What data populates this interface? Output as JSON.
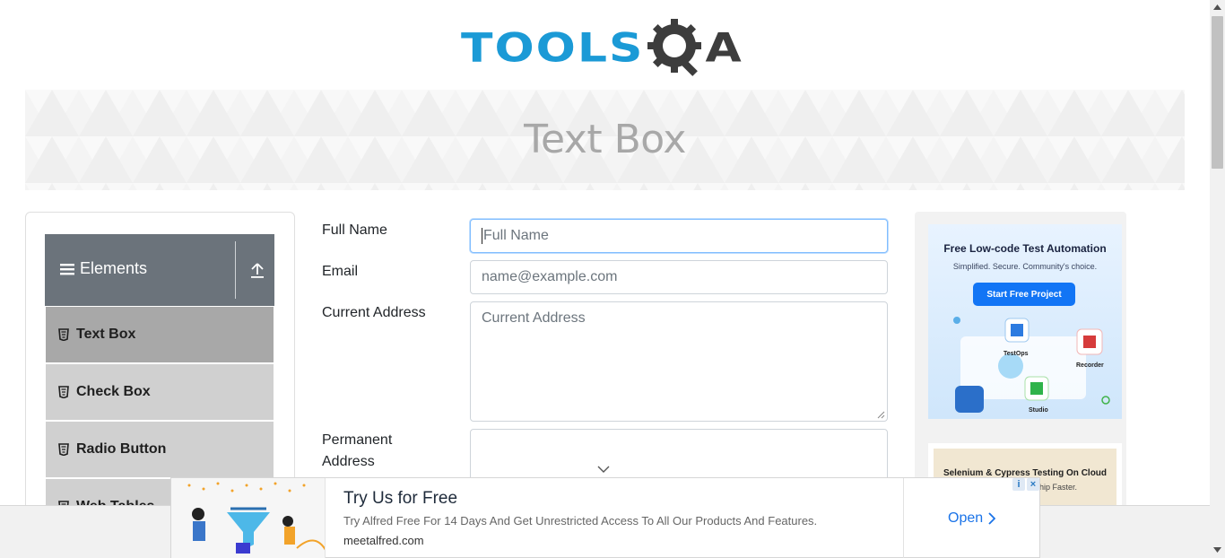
{
  "logo": {
    "word1": "TOOLS",
    "word2": "A"
  },
  "banner": {
    "title": "Text Box"
  },
  "sidebar": {
    "group_title": "Elements",
    "items": [
      {
        "label": "Text Box"
      },
      {
        "label": "Check Box"
      },
      {
        "label": "Radio Button"
      },
      {
        "label": "Web Tables"
      }
    ]
  },
  "form": {
    "full_name": {
      "label": "Full Name",
      "placeholder": "Full Name"
    },
    "email": {
      "label": "Email",
      "placeholder": "name@example.com"
    },
    "current_address": {
      "label": "Current Address",
      "placeholder": "Current Address"
    },
    "permanent_address": {
      "label_line1": "Permanent",
      "label_line2": "Address"
    }
  },
  "right_ads": {
    "ad1": {
      "heading": "Free Low-code Test Automation",
      "subheading": "Simplified. Secure. Community's choice.",
      "button": "Start Free Project",
      "tag_testops": "TestOps",
      "tag_recorder": "Recorder",
      "tag_studio": "Studio"
    },
    "ad2": {
      "heading": "Selenium & Cypress Testing On Cloud",
      "subheading": "Ship Faster."
    }
  },
  "bottom_ad": {
    "title": "Try Us for Free",
    "description": "Try Alfred Free For 14 Days And Get Unrestricted Access To All Our Products And Features.",
    "url": "meetalfred.com",
    "cta": "Open"
  },
  "colors": {
    "brand_blue": "#1b9ad6",
    "brand_dark": "#3d3d3d",
    "group_header": "#6b737b",
    "menu_active": "#a8a8a8",
    "menu_item": "#d0d0d0",
    "link_blue": "#1a73e8"
  }
}
